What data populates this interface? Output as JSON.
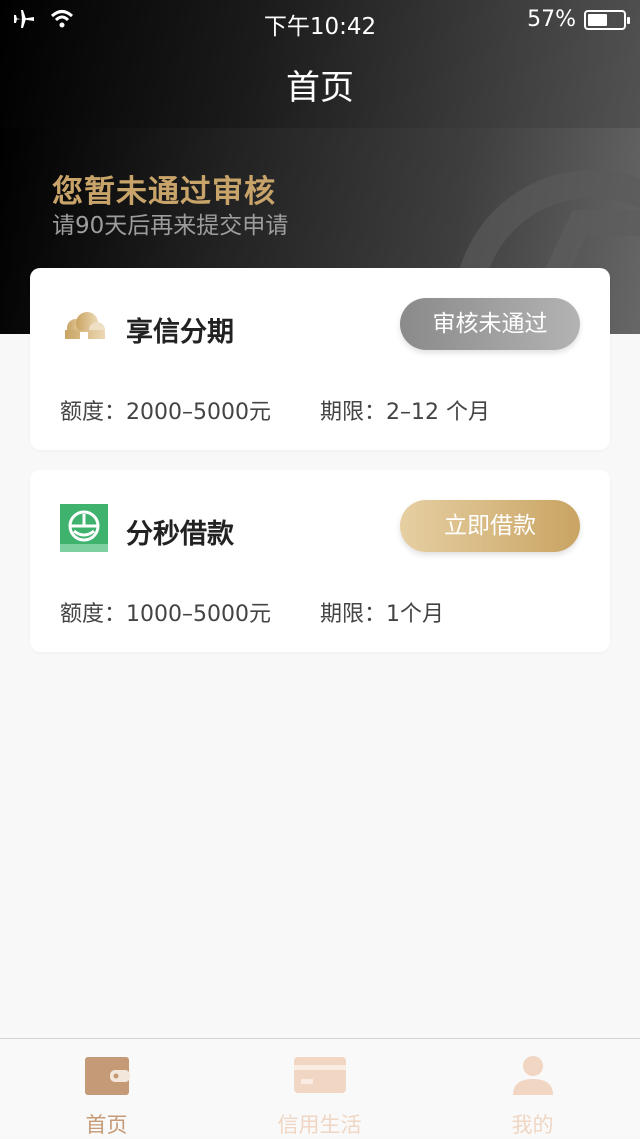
{
  "status_bar": {
    "time": "下午10:42",
    "battery": "57%",
    "battery_level": 0.57
  },
  "nav": {
    "title": "首页"
  },
  "notice": {
    "title": "您暂未通过审核",
    "subtitle": "请90天后再来提交申请"
  },
  "cards": [
    {
      "name": "享信分期",
      "action": "审核未通过",
      "amount": "额度：2000–5000元",
      "term": "期限：2–12 个月"
    },
    {
      "name": "分秒借款",
      "action": "立即借款",
      "amount": "额度：1000–5000元",
      "term": "期限：1个月"
    }
  ],
  "tabbar": {
    "items": [
      {
        "label": "首页",
        "icon": "wallet-icon",
        "active": true
      },
      {
        "label": "信用生活",
        "icon": "card-icon",
        "active": false
      },
      {
        "label": "我的",
        "icon": "user-icon",
        "active": false
      }
    ]
  },
  "colors": {
    "gold": "#c9a46a",
    "tab_active": "#c59a77",
    "tab_inactive": "#f0d6c3"
  }
}
